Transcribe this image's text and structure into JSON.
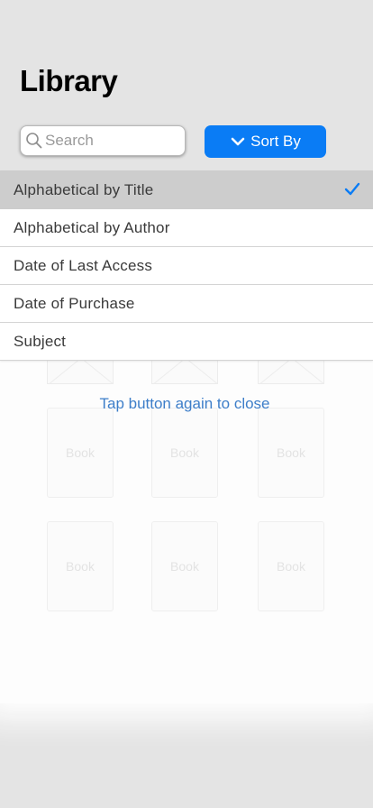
{
  "header": {
    "title": "Library"
  },
  "search": {
    "placeholder": "Search",
    "value": ""
  },
  "sort_button": {
    "label": "Sort By",
    "color": "#0a7cf5"
  },
  "sort_menu": {
    "selected_index": 0,
    "items": [
      {
        "label": "Alphabetical by Title",
        "selected": true
      },
      {
        "label": "Alphabetical by Author",
        "selected": false
      },
      {
        "label": "Date of Last Access",
        "selected": false
      },
      {
        "label": "Date of Purchase",
        "selected": false
      },
      {
        "label": "Subject",
        "selected": false
      }
    ]
  },
  "hint": {
    "text": "Tap button again to close",
    "color": "#3d7ec9"
  },
  "books": [
    {
      "label": "Book"
    },
    {
      "label": "Book"
    },
    {
      "label": "Book"
    },
    {
      "label": "Book"
    },
    {
      "label": "Book"
    },
    {
      "label": "Book"
    }
  ]
}
